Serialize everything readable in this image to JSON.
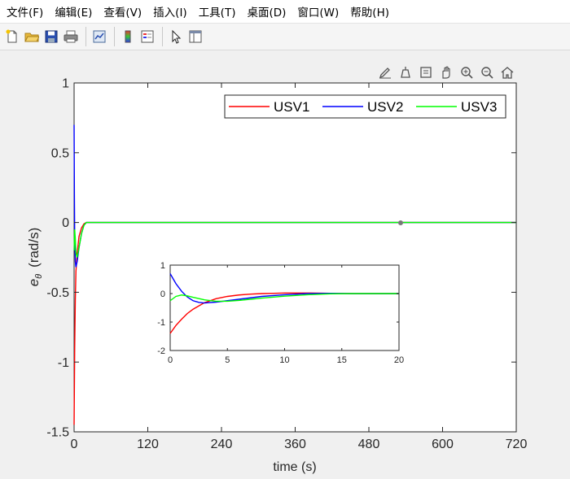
{
  "menu": [
    "文件(F)",
    "编辑(E)",
    "查看(V)",
    "插入(I)",
    "工具(T)",
    "桌面(D)",
    "窗口(W)",
    "帮助(H)"
  ],
  "toolbar_icons": [
    "new-file-icon",
    "open-folder-icon",
    "save-icon",
    "print-icon",
    "link-plot-icon",
    "colorbar-icon",
    "legend-icon",
    "pointer-icon",
    "property-editor-icon"
  ],
  "axes_toolbar_icons": [
    "brush-icon",
    "data-tip-icon",
    "export-icon",
    "pan-icon",
    "zoom-in-icon",
    "zoom-out-icon",
    "home-icon"
  ],
  "colors": {
    "USV1": "#ff0000",
    "USV2": "#0000ff",
    "USV3": "#00ff00"
  },
  "chart_data": [
    {
      "type": "line",
      "xlabel": "time (s)",
      "ylabel_symbol": "e",
      "ylabel_subscript": "θ",
      "ylabel_units": "(rad/s)",
      "xlim": [
        0,
        720
      ],
      "ylim": [
        -1.5,
        1
      ],
      "xticks": [
        0,
        120,
        240,
        360,
        480,
        600,
        720
      ],
      "yticks": [
        -1.5,
        -1,
        -0.5,
        0,
        0.5,
        1
      ],
      "ytick_labels": [
        "-1.5",
        "-1",
        "-0.5",
        "0",
        "0.5",
        "1"
      ],
      "legend": {
        "entries": [
          "USV1",
          "USV2",
          "USV3"
        ],
        "location": "top-right"
      },
      "grid": false,
      "series": [
        {
          "name": "USV1",
          "x": [
            0,
            1,
            2,
            3,
            5,
            8,
            12,
            16,
            20,
            720
          ],
          "y": [
            -1.45,
            -0.9,
            -0.55,
            -0.35,
            -0.22,
            -0.1,
            -0.04,
            -0.01,
            0,
            0
          ]
        },
        {
          "name": "USV2",
          "x": [
            0,
            0.5,
            1,
            2,
            3,
            5,
            8,
            12,
            16,
            20,
            720
          ],
          "y": [
            0.7,
            0.2,
            -0.1,
            -0.28,
            -0.32,
            -0.28,
            -0.18,
            -0.08,
            -0.02,
            0,
            0
          ]
        },
        {
          "name": "USV3",
          "x": [
            0,
            1,
            2,
            3,
            5,
            8,
            12,
            16,
            20,
            720
          ],
          "y": [
            -0.2,
            -0.05,
            -0.12,
            -0.22,
            -0.25,
            -0.18,
            -0.08,
            -0.02,
            0,
            0
          ]
        }
      ]
    },
    {
      "type": "line",
      "xlim": [
        0,
        20
      ],
      "ylim": [
        -2,
        1
      ],
      "xticks": [
        0,
        5,
        10,
        15,
        20
      ],
      "yticks": [
        -2,
        -1,
        0,
        1
      ],
      "ytick_labels": [
        "-2",
        "-1",
        "0",
        "1"
      ],
      "grid": false,
      "series": [
        {
          "name": "USV1",
          "x": [
            0,
            0.5,
            1,
            1.5,
            2,
            3,
            4,
            5,
            6,
            7,
            8,
            9,
            10,
            12,
            14,
            16,
            20
          ],
          "y": [
            -1.4,
            -1.12,
            -0.9,
            -0.7,
            -0.55,
            -0.32,
            -0.18,
            -0.1,
            -0.05,
            -0.02,
            0,
            0.01,
            0.02,
            0.02,
            0.01,
            0,
            0
          ]
        },
        {
          "name": "USV2",
          "x": [
            0,
            0.5,
            1,
            1.5,
            2,
            2.5,
            3,
            4,
            5,
            6,
            7,
            8,
            10,
            12,
            14,
            16,
            20
          ],
          "y": [
            0.7,
            0.35,
            0.08,
            -0.12,
            -0.25,
            -0.31,
            -0.33,
            -0.3,
            -0.25,
            -0.2,
            -0.15,
            -0.1,
            -0.04,
            0,
            0.01,
            0,
            0
          ]
        },
        {
          "name": "USV3",
          "x": [
            0,
            0.5,
            1,
            1.5,
            2,
            3,
            4,
            5,
            6,
            7,
            8,
            10,
            12,
            14,
            16,
            20
          ],
          "y": [
            -0.25,
            -0.1,
            -0.05,
            -0.08,
            -0.13,
            -0.22,
            -0.27,
            -0.27,
            -0.24,
            -0.2,
            -0.16,
            -0.09,
            -0.04,
            -0.01,
            0,
            0
          ]
        }
      ]
    }
  ]
}
